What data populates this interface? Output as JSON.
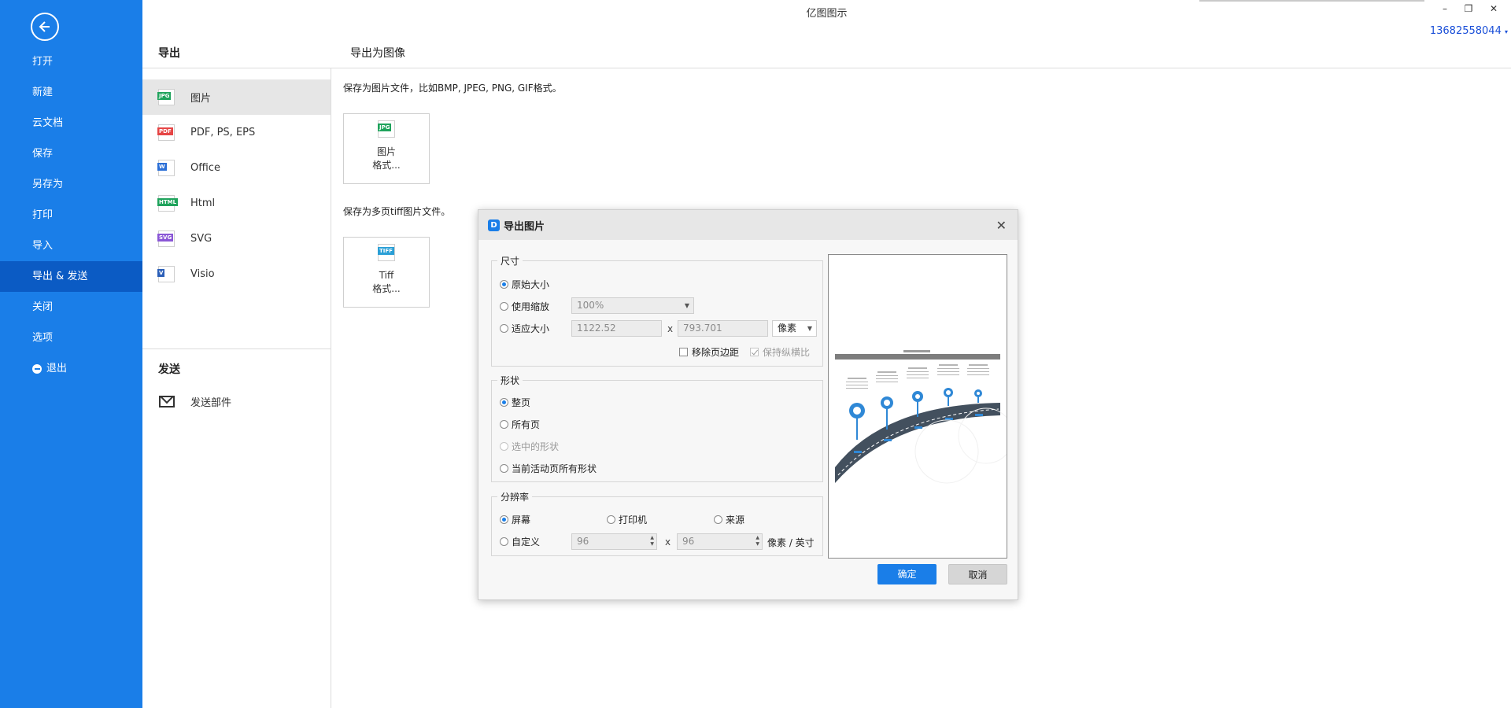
{
  "app_title": "亿图图示",
  "user": "13682558044",
  "nav": {
    "items": [
      "打开",
      "新建",
      "云文档",
      "保存",
      "另存为",
      "打印",
      "导入",
      "导出 & 发送",
      "关闭",
      "选项",
      "退出"
    ],
    "active": "导出 & 发送"
  },
  "export_header": "导出",
  "export_menu": [
    {
      "label": "图片",
      "icon": "jpg-file-icon",
      "tag": "JPG",
      "color": "#1fa35c"
    },
    {
      "label": "PDF, PS, EPS",
      "icon": "pdf-file-icon",
      "tag": "PDF",
      "color": "#e64545"
    },
    {
      "label": "Office",
      "icon": "word-file-icon",
      "tag": "W",
      "color": "#2b6fd6"
    },
    {
      "label": "Html",
      "icon": "html-file-icon",
      "tag": "HTML",
      "color": "#1fa35c"
    },
    {
      "label": "SVG",
      "icon": "svg-file-icon",
      "tag": "SVG",
      "color": "#8a56d6"
    },
    {
      "label": "Visio",
      "icon": "visio-file-icon",
      "tag": "V",
      "color": "#2b5fb8"
    }
  ],
  "send_header": "发送",
  "send_mail": "发送部件",
  "image_header": "导出为图像",
  "desc_image": "保存为图片文件，比如BMP, JPEG, PNG, GIF格式。",
  "tile_image": {
    "line1": "图片",
    "line2": "格式...",
    "tag": "JPG"
  },
  "desc_tiff": "保存为多页tiff图片文件。",
  "tile_tiff": {
    "line1": "Tiff",
    "line2": "格式...",
    "tag": "TIFF"
  },
  "dialog": {
    "title": "导出图片",
    "size_group": "尺寸",
    "opt_original": "原始大小",
    "opt_zoom": "使用缩放",
    "zoom_value": "100%",
    "opt_fit": "适应大小",
    "fit_width": "1122.52",
    "fit_height": "793.701",
    "unit_select": "像素",
    "remove_margin": "移除页边距",
    "keep_ratio": "保持纵横比",
    "shape_group": "形状",
    "opt_whole_page": "整页",
    "opt_all_pages": "所有页",
    "opt_selected": "选中的形状",
    "opt_current_all": "当前活动页所有形状",
    "res_group": "分辨率",
    "opt_screen": "屏幕",
    "opt_printer": "打印机",
    "opt_source": "来源",
    "opt_custom": "自定义",
    "dpi_x": "96",
    "dpi_y": "96",
    "res_unit": "像素 / 英寸",
    "x_sep": "x",
    "ok": "确定",
    "cancel": "取消"
  }
}
